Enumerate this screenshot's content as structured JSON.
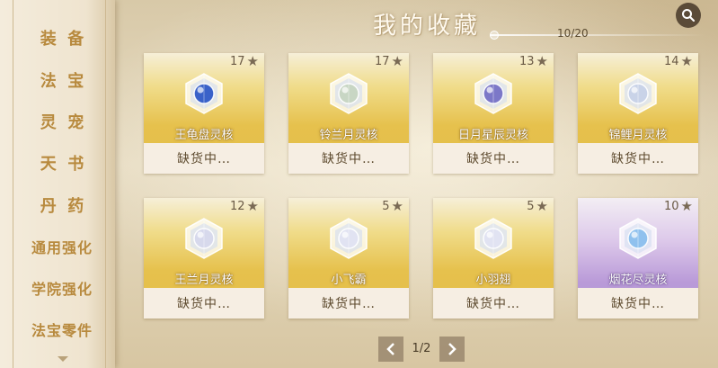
{
  "title": "我的收藏",
  "count": "10/20",
  "sidebar": {
    "items": [
      {
        "label": "装  备"
      },
      {
        "label": "法  宝"
      },
      {
        "label": "灵  宠"
      },
      {
        "label": "天  书"
      },
      {
        "label": "丹  药"
      },
      {
        "label": "通用强化"
      },
      {
        "label": "学院强化"
      },
      {
        "label": "法宝零件"
      }
    ]
  },
  "cards": [
    {
      "stars": "17",
      "name": "王龟盘灵核",
      "status": "缺货中…",
      "theme": "gold",
      "gem_color": "#3a62c9"
    },
    {
      "stars": "17",
      "name": "铃兰月灵核",
      "status": "缺货中…",
      "theme": "gold",
      "gem_color": "#c8d6c4"
    },
    {
      "stars": "13",
      "name": "日月星辰灵核",
      "status": "缺货中…",
      "theme": "gold",
      "gem_color": "#7c78c8"
    },
    {
      "stars": "14",
      "name": "锦鲤月灵核",
      "status": "缺货中…",
      "theme": "gold",
      "gem_color": "#c9d3e8"
    },
    {
      "stars": "12",
      "name": "王兰月灵核",
      "status": "缺货中…",
      "theme": "gold",
      "gem_color": "#d7d9ec"
    },
    {
      "stars": "5",
      "name": "小飞霸",
      "status": "缺货中…",
      "theme": "gold",
      "gem_color": "#e1e3f2"
    },
    {
      "stars": "5",
      "name": "小羽翅",
      "status": "缺货中…",
      "theme": "gold",
      "gem_color": "#e1e3f2"
    },
    {
      "stars": "10",
      "name": "烟花尽灵核",
      "status": "缺货中…",
      "theme": "purple",
      "gem_color": "#8fc1ee"
    }
  ],
  "pager": {
    "page": "1/2"
  },
  "icons": {
    "search": "search-icon",
    "prev": "chevron-left-icon",
    "next": "chevron-right-icon",
    "star": "star-icon",
    "scroll": "chevron-down-icon"
  }
}
